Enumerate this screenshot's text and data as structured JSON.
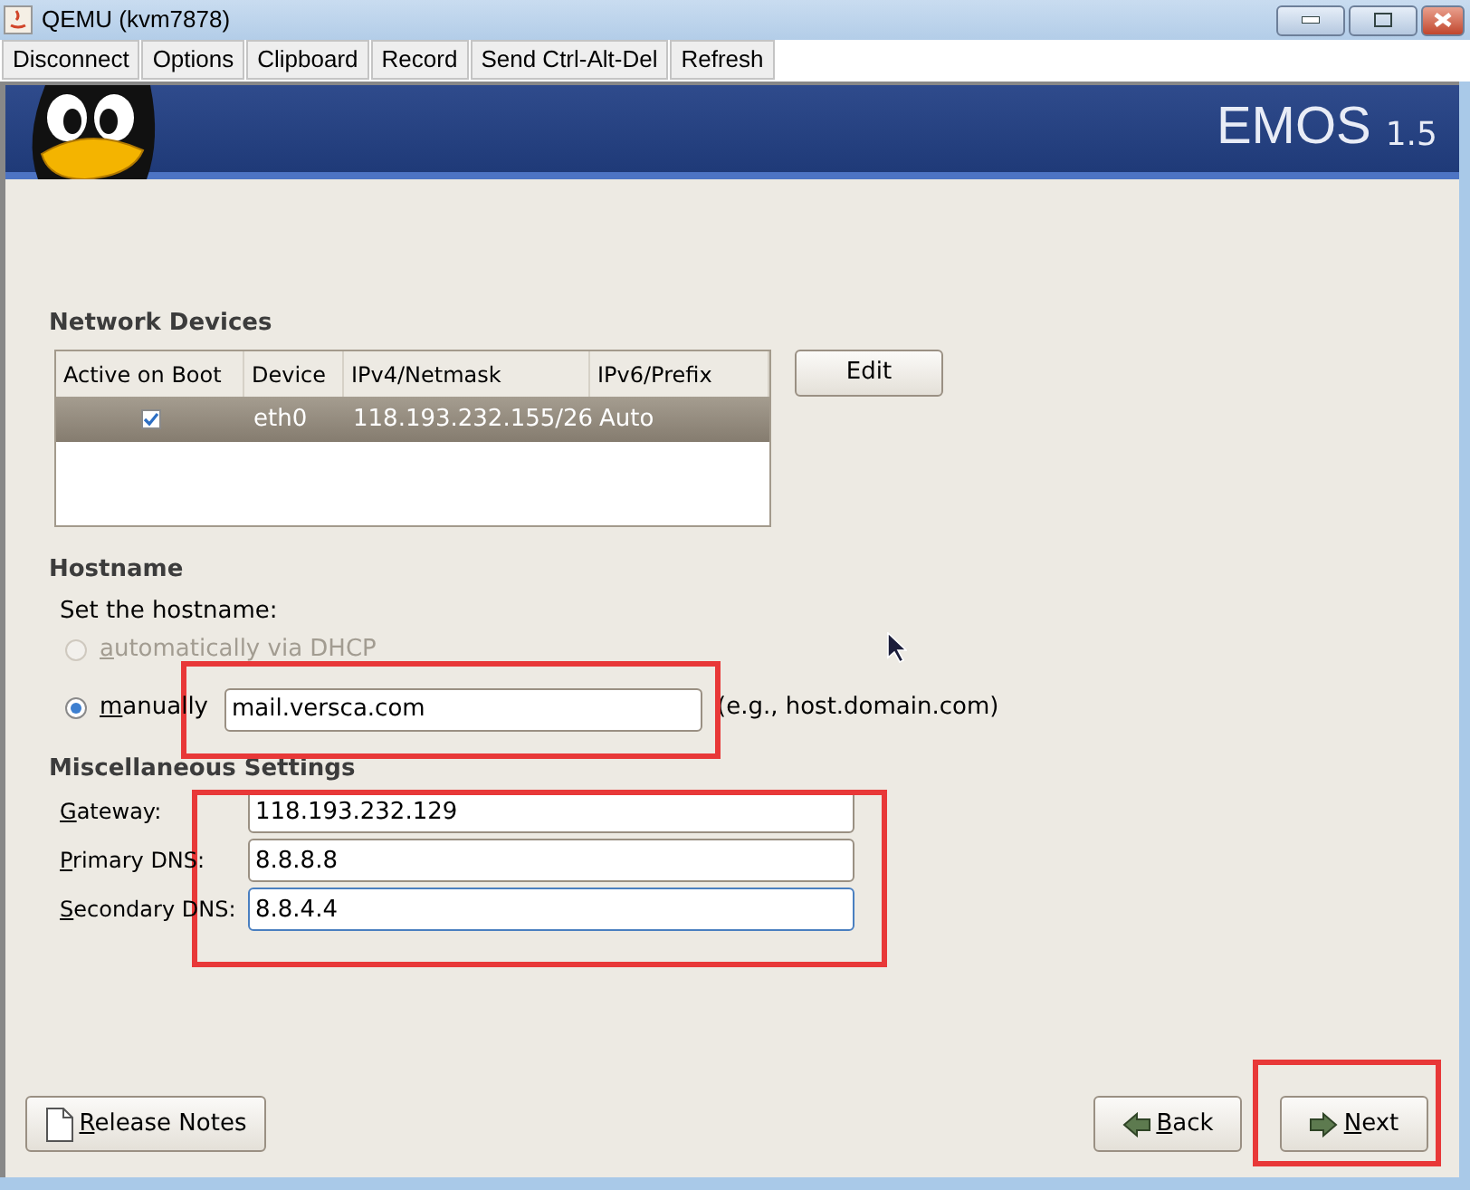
{
  "window": {
    "title": "QEMU (kvm7878)"
  },
  "toolbar": [
    "Disconnect",
    "Options",
    "Clipboard",
    "Record",
    "Send Ctrl-Alt-Del",
    "Refresh"
  ],
  "banner": {
    "product": "EMOS",
    "version": "1.5"
  },
  "network_devices": {
    "title": "Network Devices",
    "columns": [
      "Active on Boot",
      "Device",
      "IPv4/Netmask",
      "IPv6/Prefix"
    ],
    "rows": [
      {
        "active": true,
        "selected": true,
        "device": "eth0",
        "ipv4": "118.193.232.155/26",
        "ipv6": "Auto"
      }
    ],
    "edit_button": "Edit"
  },
  "hostname": {
    "title": "Hostname",
    "prompt": "Set the hostname:",
    "options": [
      {
        "label": "automatically via DHCP",
        "selected": false,
        "disabled": true
      },
      {
        "label": "manually",
        "selected": true,
        "disabled": false
      }
    ],
    "value": "mail.versca.com",
    "hint": "(e.g., host.domain.com)"
  },
  "misc": {
    "title": "Miscellaneous Settings",
    "fields": [
      {
        "label": "Gateway:",
        "value": "118.193.232.129",
        "focused": false
      },
      {
        "label": "Primary DNS:",
        "value": "8.8.8.8",
        "focused": false
      },
      {
        "label": "Secondary DNS:",
        "value": "8.8.4.4",
        "focused": true
      }
    ]
  },
  "buttons": {
    "release_notes": "Release Notes",
    "back": "Back",
    "next": "Next"
  }
}
